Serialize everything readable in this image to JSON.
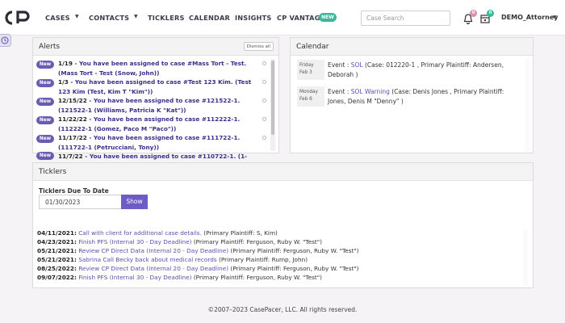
{
  "nav": {
    "items": [
      "CASES",
      "CONTACTS",
      "TICKLERS",
      "CALENDAR",
      "INSIGHTS",
      "CP VANTAGE"
    ],
    "new_pill": "NEW",
    "search_placeholder": "Case Search",
    "notif_count": "0",
    "calendar_count": "0",
    "user": "DEMO_Attorney",
    "accent_color": "#6e5bc8"
  },
  "alerts": {
    "title": "Alerts",
    "dismiss_label": "Dismiss all",
    "badge": "New",
    "items": [
      {
        "date": "1/19",
        "text": " - You have been assigned to case #Mass Tort - Test. (Mass Tort - Test (Snow, John))"
      },
      {
        "date": "1/3",
        "text": " - You have been assigned to case #Test 123 Kim. (Test 123 Kim (Test, Kim T \"Kim\"))"
      },
      {
        "date": "12/15/22",
        "text": " - You have been assigned to case #121522-1. (121522-1 (Williams, Patricia K \"Kat\"))"
      },
      {
        "date": "11/22/22",
        "text": " - You have been assigned to case #112222-1. (112222-1 (Gomez, Paco M \"Paco\"))"
      },
      {
        "date": "11/17/22",
        "text": " - You have been assigned to case #111722-1. (111722-1 (Petrucciani, Tony))"
      },
      {
        "date": "11/7/22",
        "text": " - You have been assigned to case #110722-1. (1-"
      }
    ]
  },
  "calendar": {
    "title": "Calendar",
    "events": [
      {
        "day": "Friday",
        "date": "Feb 3",
        "prefix": "Event : ",
        "label": "SOL",
        "detail": " (Case: 012220-1 , Primary Plaintiff: Andersen, Deborah )"
      },
      {
        "day": "Monday",
        "date": "Feb 6",
        "prefix": "Event : ",
        "label": "SOL Warning",
        "detail": " (Case: Denis Jones , Primary Plaintiff: Jones, Denis M \"Denny\" )"
      }
    ]
  },
  "ticklers": {
    "title": "Ticklers",
    "due_label": "Ticklers Due To Date",
    "date_value": "01/30/2023",
    "show_label": "Show",
    "items": [
      {
        "date": "04/11/2021:",
        "link": " Call with client for additional case details.",
        "detail": " (Primary Plaintiff: S, Kim)"
      },
      {
        "date": "04/23/2021:",
        "link": " Finish PFS (Internal 30 - Day Deadline)",
        "detail": " (Primary Plaintiff: Ferguson, Ruby W. \"Test\")"
      },
      {
        "date": "05/21/2021:",
        "link": " Review CP Direct Data (Internal 20 - Day Deadline)",
        "detail": " (Primary Plaintiff: Ferguson, Ruby W. \"Test\")"
      },
      {
        "date": "05/21/2021:",
        "link": " Sabrina Call Becky back about medical records",
        "detail": " (Primary Plaintiff: Rump, John)"
      },
      {
        "date": "08/25/2022:",
        "link": " Review CP Direct Data (Internal 20 - Day Deadline)",
        "detail": " (Primary Plaintiff: Ferguson, Ruby W. \"Test\")"
      },
      {
        "date": "09/07/2022:",
        "link": " Finish PFS (Internal 30 - Day Deadline)",
        "detail": " (Primary Plaintiff: Ferguson, Ruby W. \"Test\")"
      }
    ]
  },
  "footer": "©2007–2023 CasePacer, LLC. All rights reserved."
}
